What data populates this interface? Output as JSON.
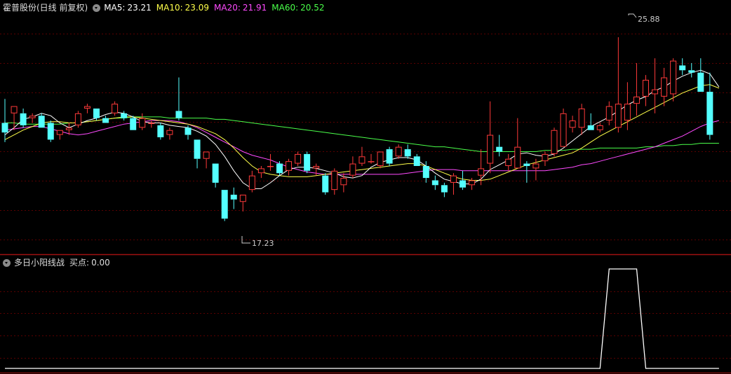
{
  "main_panel": {
    "stock_title": "霍普股份(日线 前复权)",
    "ma_legend": [
      {
        "label": "MA5:",
        "value": "23.21",
        "color": "#ffffff"
      },
      {
        "label": "MA10:",
        "value": "23.09",
        "color": "#ffff4a"
      },
      {
        "label": "MA20:",
        "value": "21.91",
        "color": "#ff4aff"
      },
      {
        "label": "MA60:",
        "value": "20.52",
        "color": "#4aff4a"
      }
    ],
    "high_marker": "25.88",
    "low_marker": "17.23"
  },
  "indicator_panel": {
    "title": "多日小阳线战",
    "value_label": "买点:",
    "value": "0.00"
  },
  "chart_data": {
    "type": "candlestick",
    "up_color": "#ff3a3a",
    "down_color": "#54ffff",
    "ylim": [
      16.9,
      26.85
    ],
    "candles": [
      {
        "o": 22.3,
        "h": 23.3,
        "l": 21.5,
        "c": 21.9
      },
      {
        "o": 22.7,
        "h": 23.0,
        "l": 22.0,
        "c": 23.0
      },
      {
        "o": 22.7,
        "h": 22.9,
        "l": 22.1,
        "c": 22.2
      },
      {
        "o": 22.5,
        "h": 22.7,
        "l": 22.3,
        "c": 22.6
      },
      {
        "o": 22.6,
        "h": 22.7,
        "l": 22.1,
        "c": 22.1
      },
      {
        "o": 22.3,
        "h": 22.4,
        "l": 21.5,
        "c": 21.6
      },
      {
        "o": 21.8,
        "h": 22.0,
        "l": 21.6,
        "c": 22.0
      },
      {
        "o": 22.0,
        "h": 22.3,
        "l": 21.8,
        "c": 22.1
      },
      {
        "o": 22.2,
        "h": 22.8,
        "l": 22.1,
        "c": 22.7
      },
      {
        "o": 22.9,
        "h": 23.1,
        "l": 22.7,
        "c": 23.0
      },
      {
        "o": 22.9,
        "h": 22.9,
        "l": 22.4,
        "c": 22.5
      },
      {
        "o": 22.5,
        "h": 22.6,
        "l": 22.3,
        "c": 22.3
      },
      {
        "o": 22.7,
        "h": 23.2,
        "l": 22.6,
        "c": 23.1
      },
      {
        "o": 22.7,
        "h": 22.8,
        "l": 22.4,
        "c": 22.5
      },
      {
        "o": 22.5,
        "h": 22.6,
        "l": 22.0,
        "c": 22.0
      },
      {
        "o": 22.1,
        "h": 22.7,
        "l": 22.0,
        "c": 22.5
      },
      {
        "o": 22.3,
        "h": 22.4,
        "l": 22.1,
        "c": 22.3
      },
      {
        "o": 22.2,
        "h": 22.3,
        "l": 21.6,
        "c": 21.7
      },
      {
        "o": 21.8,
        "h": 22.1,
        "l": 21.6,
        "c": 22.0
      },
      {
        "o": 22.8,
        "h": 24.2,
        "l": 22.4,
        "c": 22.5
      },
      {
        "o": 22.1,
        "h": 22.2,
        "l": 21.6,
        "c": 21.8
      },
      {
        "o": 21.6,
        "h": 21.6,
        "l": 20.4,
        "c": 20.8
      },
      {
        "o": 20.8,
        "h": 21.1,
        "l": 20.4,
        "c": 21.1
      },
      {
        "o": 20.6,
        "h": 20.6,
        "l": 19.6,
        "c": 19.8
      },
      {
        "o": 19.5,
        "h": 19.5,
        "l": 18.2,
        "c": 18.3
      },
      {
        "o": 19.3,
        "h": 19.6,
        "l": 18.7,
        "c": 19.1
      },
      {
        "o": 19.0,
        "h": 19.3,
        "l": 18.6,
        "c": 19.3
      },
      {
        "o": 19.5,
        "h": 20.3,
        "l": 19.4,
        "c": 20.1
      },
      {
        "o": 20.2,
        "h": 20.5,
        "l": 20.0,
        "c": 20.4
      },
      {
        "o": 20.5,
        "h": 21.0,
        "l": 20.3,
        "c": 20.5
      },
      {
        "o": 20.6,
        "h": 20.7,
        "l": 20.1,
        "c": 20.2
      },
      {
        "o": 20.3,
        "h": 20.8,
        "l": 20.1,
        "c": 20.7
      },
      {
        "o": 20.6,
        "h": 21.1,
        "l": 20.5,
        "c": 21.0
      },
      {
        "o": 21.0,
        "h": 21.1,
        "l": 20.2,
        "c": 20.3
      },
      {
        "o": 20.4,
        "h": 20.6,
        "l": 20.1,
        "c": 20.5
      },
      {
        "o": 20.1,
        "h": 20.2,
        "l": 19.3,
        "c": 19.4
      },
      {
        "o": 19.5,
        "h": 20.4,
        "l": 19.3,
        "c": 20.3
      },
      {
        "o": 19.7,
        "h": 20.2,
        "l": 19.4,
        "c": 20.0
      },
      {
        "o": 20.1,
        "h": 20.9,
        "l": 20.0,
        "c": 20.6
      },
      {
        "o": 20.6,
        "h": 21.3,
        "l": 20.5,
        "c": 20.9
      },
      {
        "o": 20.7,
        "h": 21.0,
        "l": 20.6,
        "c": 20.7
      },
      {
        "o": 20.5,
        "h": 21.1,
        "l": 20.4,
        "c": 21.1
      },
      {
        "o": 21.2,
        "h": 21.3,
        "l": 20.5,
        "c": 20.6
      },
      {
        "o": 20.9,
        "h": 21.4,
        "l": 20.8,
        "c": 21.3
      },
      {
        "o": 21.2,
        "h": 21.4,
        "l": 20.8,
        "c": 20.9
      },
      {
        "o": 20.9,
        "h": 21.0,
        "l": 20.5,
        "c": 20.5
      },
      {
        "o": 20.5,
        "h": 20.7,
        "l": 19.8,
        "c": 20.0
      },
      {
        "o": 19.9,
        "h": 20.1,
        "l": 19.5,
        "c": 19.7
      },
      {
        "o": 19.7,
        "h": 19.8,
        "l": 19.2,
        "c": 19.4
      },
      {
        "o": 19.8,
        "h": 20.2,
        "l": 19.3,
        "c": 20.1
      },
      {
        "o": 19.9,
        "h": 20.3,
        "l": 19.5,
        "c": 19.6
      },
      {
        "o": 19.7,
        "h": 20.0,
        "l": 19.5,
        "c": 19.9
      },
      {
        "o": 20.1,
        "h": 21.2,
        "l": 19.7,
        "c": 20.4
      },
      {
        "o": 20.6,
        "h": 23.2,
        "l": 20.2,
        "c": 21.8
      },
      {
        "o": 21.3,
        "h": 21.8,
        "l": 20.9,
        "c": 21.1
      },
      {
        "o": 20.5,
        "h": 21.0,
        "l": 20.3,
        "c": 20.8
      },
      {
        "o": 20.4,
        "h": 22.5,
        "l": 20.4,
        "c": 21.3
      },
      {
        "o": 20.6,
        "h": 20.7,
        "l": 19.8,
        "c": 20.5
      },
      {
        "o": 20.4,
        "h": 20.8,
        "l": 19.9,
        "c": 20.6
      },
      {
        "o": 20.7,
        "h": 21.1,
        "l": 20.5,
        "c": 21.0
      },
      {
        "o": 21.0,
        "h": 22.1,
        "l": 20.9,
        "c": 22.0
      },
      {
        "o": 21.3,
        "h": 22.9,
        "l": 21.3,
        "c": 22.7
      },
      {
        "o": 22.1,
        "h": 22.6,
        "l": 21.9,
        "c": 22.4
      },
      {
        "o": 22.1,
        "h": 23.1,
        "l": 21.8,
        "c": 22.9
      },
      {
        "o": 22.2,
        "h": 22.7,
        "l": 22.0,
        "c": 22.0
      },
      {
        "o": 22.0,
        "h": 22.3,
        "l": 21.9,
        "c": 22.2
      },
      {
        "o": 22.4,
        "h": 23.2,
        "l": 22.2,
        "c": 23.0
      },
      {
        "o": 22.1,
        "h": 25.88,
        "l": 21.9,
        "c": 23.1
      },
      {
        "o": 22.4,
        "h": 24.0,
        "l": 22.0,
        "c": 23.1
      },
      {
        "o": 23.1,
        "h": 24.8,
        "l": 22.6,
        "c": 23.4
      },
      {
        "o": 23.4,
        "h": 24.3,
        "l": 23.0,
        "c": 24.1
      },
      {
        "o": 23.5,
        "h": 25.0,
        "l": 22.7,
        "c": 23.7
      },
      {
        "o": 23.4,
        "h": 24.6,
        "l": 23.0,
        "c": 24.2
      },
      {
        "o": 23.5,
        "h": 25.0,
        "l": 23.2,
        "c": 24.9
      },
      {
        "o": 24.7,
        "h": 25.0,
        "l": 24.3,
        "c": 24.5
      },
      {
        "o": 24.5,
        "h": 24.8,
        "l": 24.2,
        "c": 24.4
      },
      {
        "o": 24.4,
        "h": 25.0,
        "l": 23.6,
        "c": 23.6
      },
      {
        "o": 23.6,
        "h": 24.4,
        "l": 21.6,
        "c": 21.8
      }
    ],
    "ma": {
      "ma5": [
        21.8,
        22.1,
        22.45,
        22.55,
        22.7,
        22.6,
        22.3,
        22.1,
        22.25,
        22.4,
        22.5,
        22.65,
        22.75,
        22.7,
        22.55,
        22.35,
        22.3,
        22.3,
        22.2,
        22.15,
        22.1,
        21.95,
        21.75,
        21.4,
        20.9,
        20.3,
        19.8,
        19.55,
        19.55,
        19.8,
        20.1,
        20.35,
        20.45,
        20.45,
        20.4,
        20.3,
        20.2,
        20.05,
        20.0,
        20.1,
        20.45,
        20.65,
        20.75,
        20.85,
        20.85,
        20.75,
        20.5,
        20.2,
        19.95,
        19.85,
        19.75,
        19.75,
        19.95,
        20.35,
        20.55,
        20.75,
        21.0,
        21.05,
        20.95,
        20.9,
        21.0,
        21.25,
        21.55,
        21.85,
        22.15,
        22.35,
        22.55,
        22.8,
        23.05,
        23.25,
        23.4,
        23.65,
        23.8,
        24.05,
        24.25,
        24.4,
        24.5,
        24.35,
        23.8
      ],
      "ma10": [
        21.6,
        21.8,
        22.0,
        22.15,
        22.3,
        22.35,
        22.35,
        22.3,
        22.3,
        22.35,
        22.4,
        22.45,
        22.5,
        22.55,
        22.55,
        22.5,
        22.45,
        22.4,
        22.35,
        22.3,
        22.25,
        22.15,
        22.0,
        21.85,
        21.6,
        21.25,
        20.85,
        20.5,
        20.25,
        20.15,
        20.1,
        20.05,
        20.05,
        20.05,
        20.1,
        20.15,
        20.2,
        20.25,
        20.3,
        20.35,
        20.4,
        20.45,
        20.5,
        20.55,
        20.6,
        20.6,
        20.5,
        20.35,
        20.2,
        20.05,
        19.95,
        19.9,
        19.9,
        19.95,
        20.1,
        20.25,
        20.4,
        20.55,
        20.65,
        20.75,
        20.85,
        20.95,
        21.05,
        21.25,
        21.5,
        21.75,
        21.95,
        22.15,
        22.35,
        22.55,
        22.75,
        22.95,
        23.15,
        23.35,
        23.55,
        23.7,
        23.85,
        23.9,
        23.75
      ],
      "ma20": [
        22.0,
        22.05,
        22.1,
        22.15,
        22.15,
        22.05,
        21.95,
        21.85,
        21.8,
        21.85,
        21.95,
        22.05,
        22.15,
        22.25,
        22.3,
        22.35,
        22.4,
        22.4,
        22.4,
        22.35,
        22.25,
        22.1,
        21.9,
        21.7,
        21.5,
        21.3,
        21.1,
        20.95,
        20.85,
        20.75,
        20.6,
        20.45,
        20.35,
        20.25,
        20.2,
        20.15,
        20.15,
        20.15,
        20.15,
        20.15,
        20.15,
        20.15,
        20.15,
        20.15,
        20.2,
        20.25,
        20.3,
        20.35,
        20.35,
        20.35,
        20.3,
        20.3,
        20.3,
        20.3,
        20.3,
        20.3,
        20.3,
        20.3,
        20.3,
        20.3,
        20.35,
        20.4,
        20.45,
        20.55,
        20.6,
        20.7,
        20.8,
        20.9,
        21.0,
        21.1,
        21.2,
        21.3,
        21.45,
        21.6,
        21.75,
        21.95,
        22.15,
        22.3,
        22.4
      ],
      "ma60": [
        22.3,
        22.3,
        22.25,
        22.25,
        22.25,
        22.25,
        22.25,
        22.3,
        22.3,
        22.35,
        22.4,
        22.45,
        22.5,
        22.5,
        22.55,
        22.55,
        22.55,
        22.55,
        22.5,
        22.5,
        22.5,
        22.5,
        22.5,
        22.45,
        22.45,
        22.4,
        22.35,
        22.3,
        22.25,
        22.2,
        22.15,
        22.1,
        22.05,
        22.0,
        21.95,
        21.9,
        21.85,
        21.8,
        21.75,
        21.7,
        21.65,
        21.6,
        21.55,
        21.5,
        21.45,
        21.4,
        21.35,
        21.3,
        21.3,
        21.25,
        21.2,
        21.15,
        21.1,
        21.1,
        21.1,
        21.1,
        21.1,
        21.1,
        21.1,
        21.15,
        21.15,
        21.15,
        21.2,
        21.2,
        21.2,
        21.25,
        21.25,
        21.25,
        21.25,
        21.25,
        21.3,
        21.3,
        21.35,
        21.35,
        21.4,
        21.4,
        21.45,
        21.45,
        21.45
      ]
    },
    "indicator": {
      "ylim": [
        0,
        1
      ],
      "values": [
        0,
        0,
        0,
        0,
        0,
        0,
        0,
        0,
        0,
        0,
        0,
        0,
        0,
        0,
        0,
        0,
        0,
        0,
        0,
        0,
        0,
        0,
        0,
        0,
        0,
        0,
        0,
        0,
        0,
        0,
        0,
        0,
        0,
        0,
        0,
        0,
        0,
        0,
        0,
        0,
        0,
        0,
        0,
        0,
        0,
        0,
        0,
        0,
        0,
        0,
        0,
        0,
        0,
        0,
        0,
        0,
        0,
        0,
        0,
        0,
        0,
        0,
        0,
        0,
        0,
        0,
        1,
        1,
        1,
        1,
        0,
        0,
        0,
        0,
        0,
        0,
        0,
        0,
        0
      ]
    }
  }
}
